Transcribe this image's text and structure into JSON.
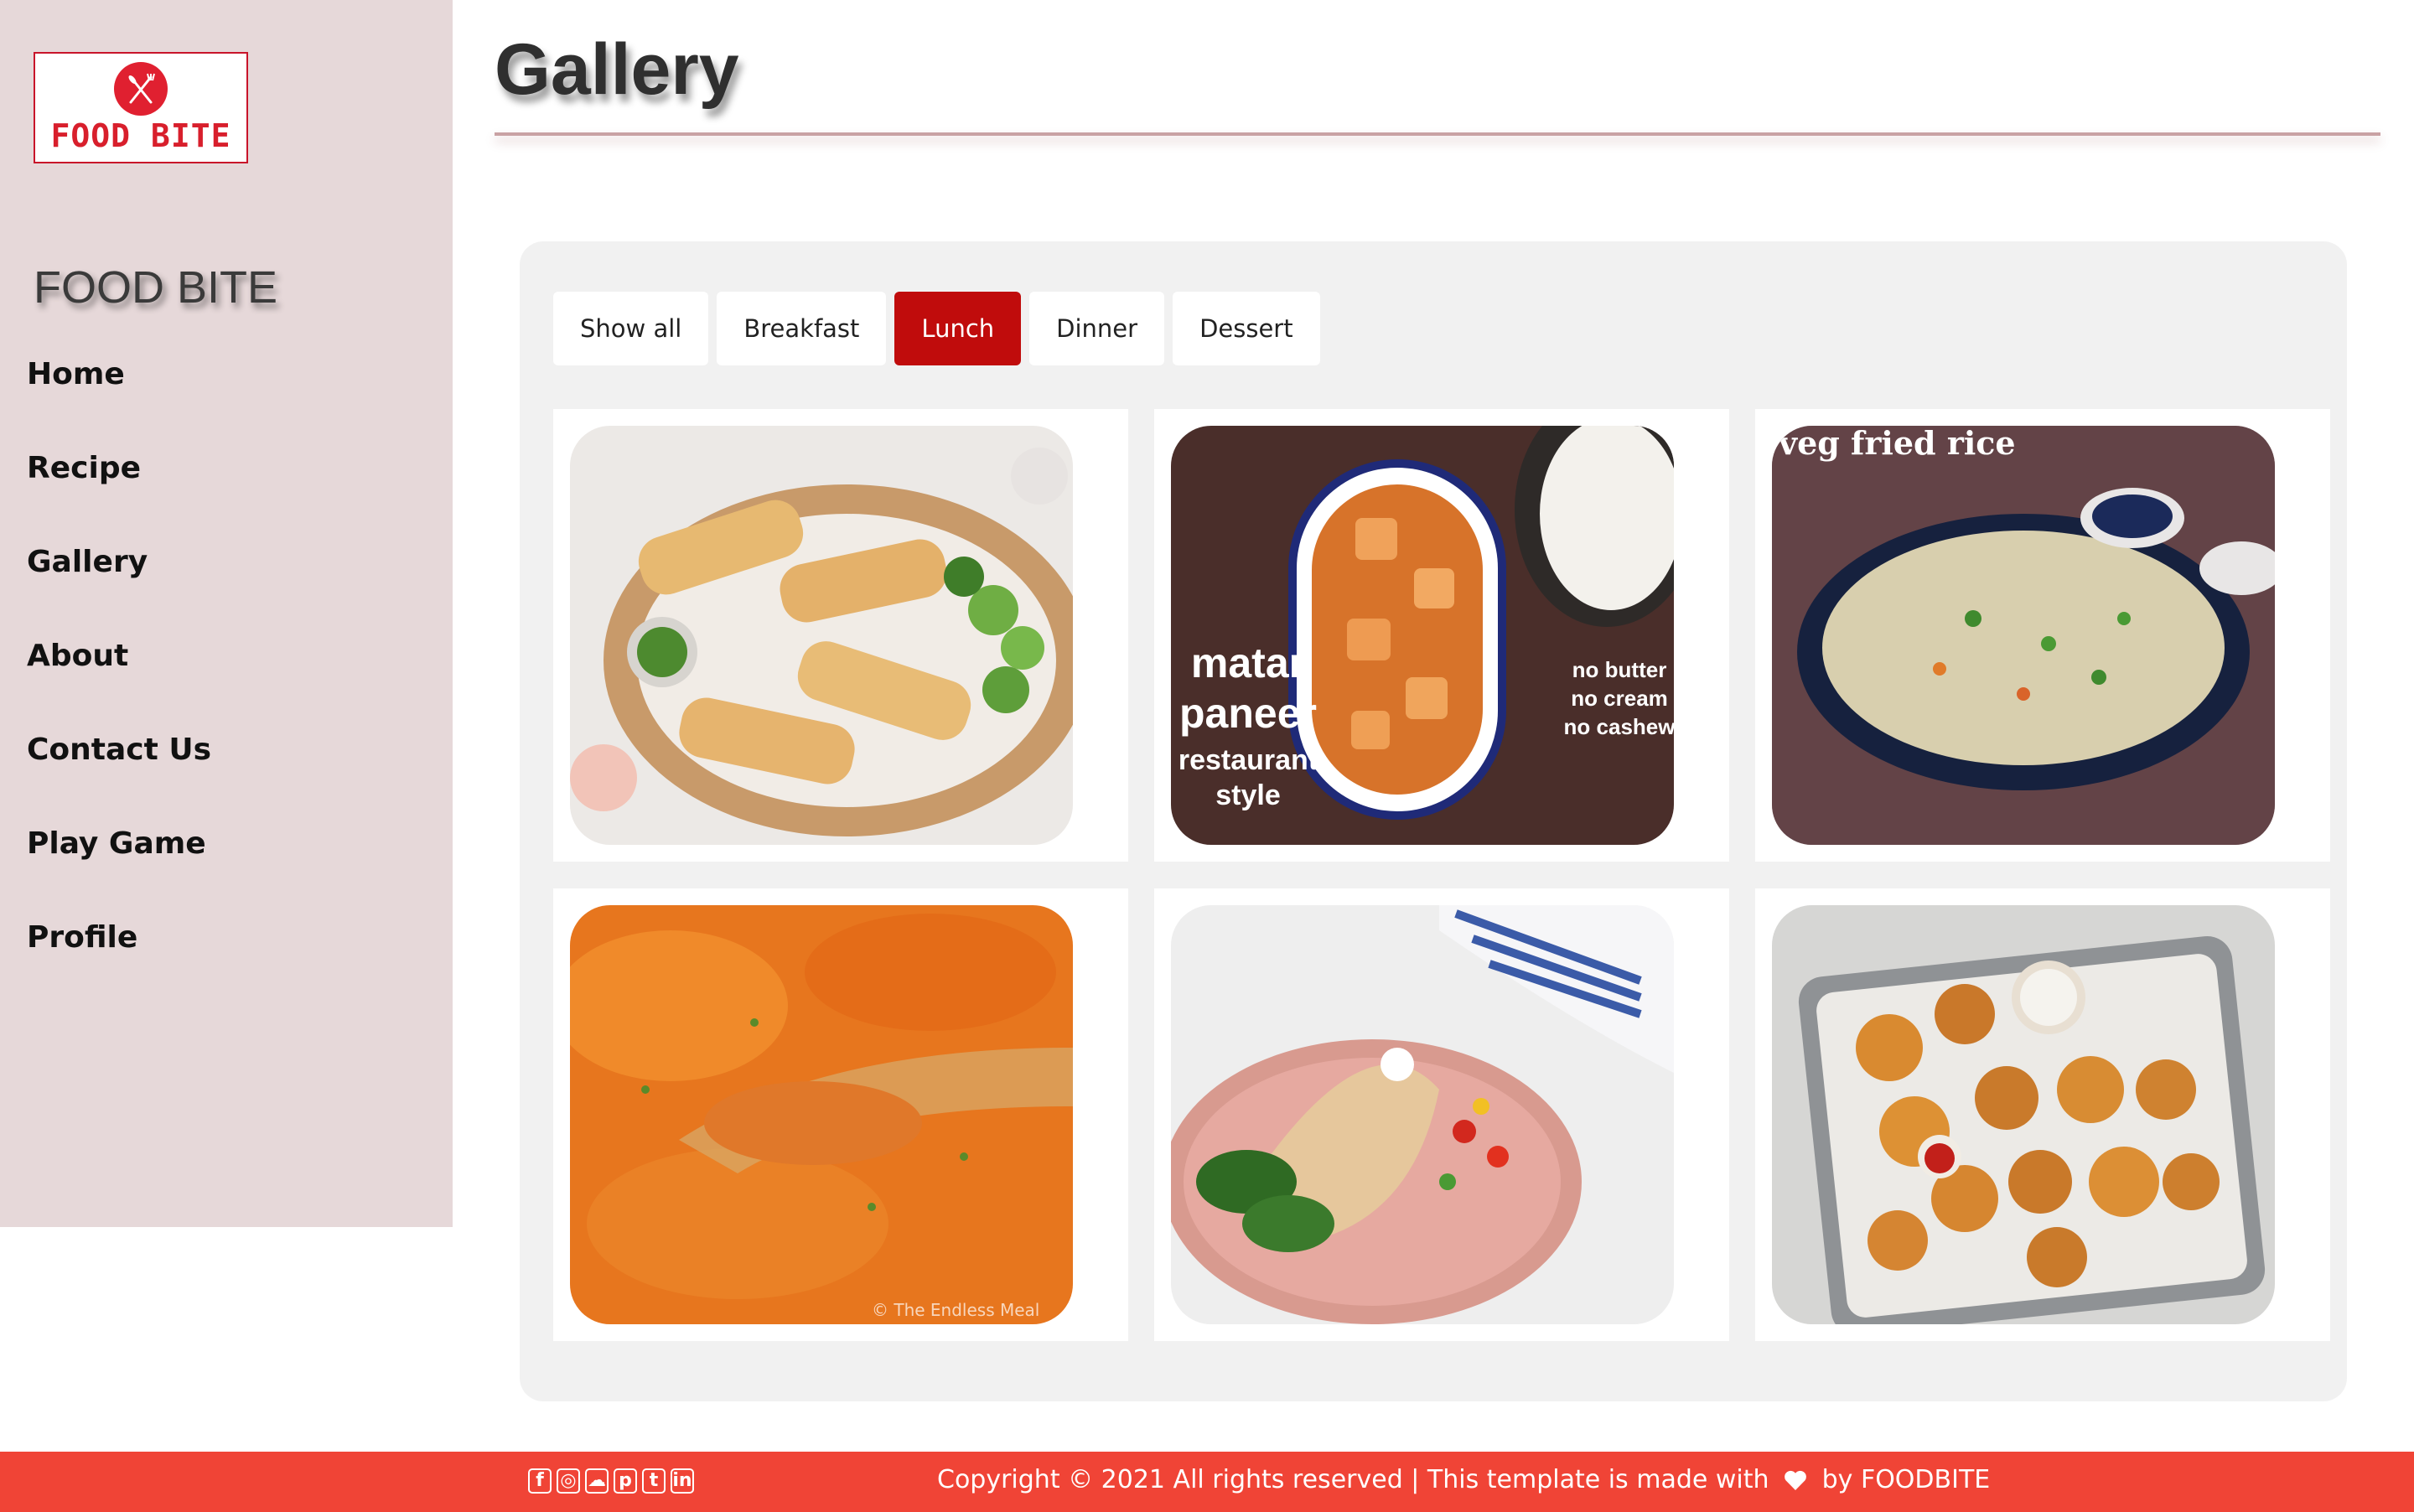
{
  "logo": {
    "text": "FOOD BITE",
    "icon": "fork-knife-icon",
    "color": "#e02030"
  },
  "sidebar": {
    "brand": "FOOD BITE",
    "items": [
      {
        "label": "Home"
      },
      {
        "label": "Recipe"
      },
      {
        "label": "Gallery"
      },
      {
        "label": "About"
      },
      {
        "label": "Contact Us"
      },
      {
        "label": "Play Game"
      },
      {
        "label": "Profile"
      }
    ],
    "background": "#e6d8d9"
  },
  "header": {
    "title": "Gallery"
  },
  "filters": {
    "items": [
      {
        "label": "Show all"
      },
      {
        "label": "Breakfast"
      },
      {
        "label": "Lunch"
      },
      {
        "label": "Dinner"
      },
      {
        "label": "Dessert"
      }
    ],
    "active": "Lunch",
    "active_color": "#c00c0c"
  },
  "gallery": {
    "items": [
      {
        "name": "sandwich-photo"
      },
      {
        "name": "matar-paneer-photo",
        "overlay_left": [
          "matar",
          "paneer",
          "restaurant",
          "style"
        ],
        "overlay_right": [
          "no butter",
          "no cream",
          "no cashew"
        ]
      },
      {
        "name": "veg-fried-rice-photo",
        "overlay": "veg fried rice"
      },
      {
        "name": "butter-chicken-photo",
        "watermark": "© The Endless Meal"
      },
      {
        "name": "wrap-salad-photo"
      },
      {
        "name": "crispy-nuggets-photo"
      }
    ]
  },
  "footer": {
    "social_icons": [
      "facebook-icon",
      "instagram-icon",
      "snapchat-icon",
      "pinterest-icon",
      "twitter-icon",
      "linkedin-icon"
    ],
    "copyright_prefix": "Copyright © 2021 All rights reserved | This template is made with",
    "copyright_suffix": "by FOODBITE",
    "background": "#f04436"
  }
}
